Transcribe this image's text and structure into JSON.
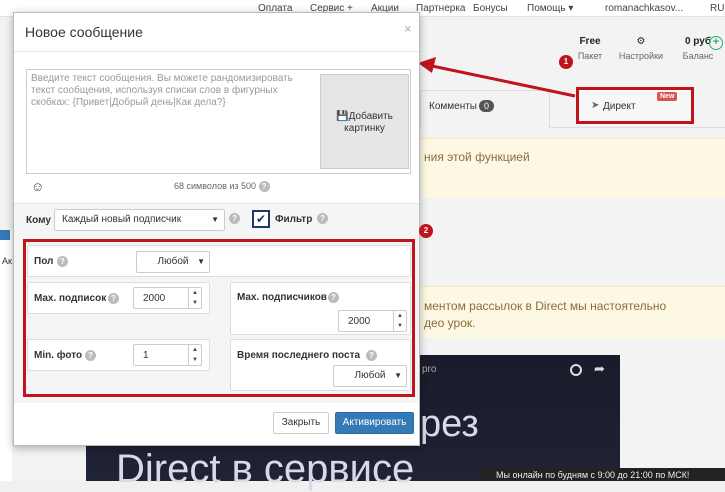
{
  "top_nav": {
    "items": [
      "Оплата",
      "Сервис +",
      "Акции",
      "Партнерка",
      "Бонусы",
      "Помощь ▾",
      "romanachkasov...",
      "RU"
    ]
  },
  "header_right": {
    "plan_value": "Free",
    "plan_label": "Пакет",
    "settings_label": "Настройки",
    "balance_value": "0 руб",
    "balance_label": "Баланс"
  },
  "tabs": {
    "comments_label": "Комменты",
    "comments_count": "0",
    "direct_label": "Директ",
    "direct_badge": "New"
  },
  "background": {
    "warning1_text": "ния этой функцией",
    "warning2_line1": "ментом рассылок в Direct мы настоятельно",
    "warning2_line2": "део урок.",
    "sidebar_fragment": "Ак",
    "video_top_text": "pro",
    "video_text_line1": "рез",
    "video_text_line2": "Direct в сервисе",
    "chat_text": "Мы онлайн по будням с 9:00 до 21:00 по МСК!"
  },
  "annotations": {
    "badge1": "1",
    "badge2": "2"
  },
  "modal": {
    "title": "Новое сообщение",
    "close_glyph": "×",
    "message_placeholder": "Введите текст сообщения. Вы можете рандомизировать текст сообщения, используя списки слов в фигурных скобках: {Привет|Добрый день|Как дела?}",
    "add_image_label": "Добавить картинку",
    "char_counter": "68 символов из 500",
    "recipient_label": "Кому",
    "recipient_value": "Каждый новый подписчик",
    "filter_label": "Фильтр",
    "filter_checked": true,
    "filters": {
      "gender_label": "Пол",
      "gender_value": "Любой",
      "max_follows_label": "Max. подписок",
      "max_follows_value": "2000",
      "max_followers_label": "Max. подписчиков",
      "max_followers_value": "2000",
      "min_photos_label": "Min. фото",
      "min_photos_value": "1",
      "last_post_label": "Время последнего поста",
      "last_post_value": "Любой"
    },
    "close_button": "Закрыть",
    "activate_button": "Активировать"
  },
  "colors": {
    "highlight_red": "#c0131b",
    "primary_blue": "#337ab7",
    "warning_bg": "#fcf8e3"
  }
}
